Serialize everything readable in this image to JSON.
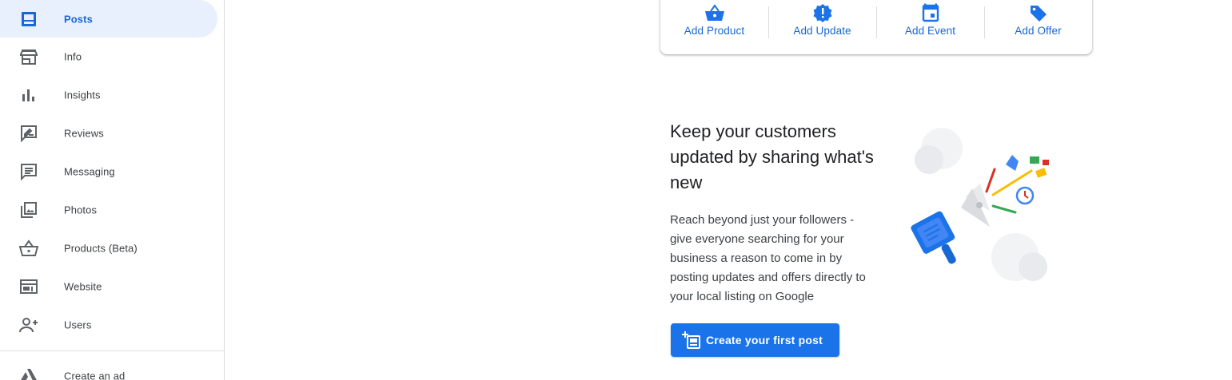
{
  "sidebar": {
    "items": [
      {
        "label": "Posts",
        "icon": "posts-icon",
        "active": true
      },
      {
        "label": "Info",
        "icon": "storefront-icon"
      },
      {
        "label": "Insights",
        "icon": "bar-chart-icon"
      },
      {
        "label": "Reviews",
        "icon": "rate-review-icon"
      },
      {
        "label": "Messaging",
        "icon": "message-icon"
      },
      {
        "label": "Photos",
        "icon": "photo-library-icon"
      },
      {
        "label": "Products (Beta)",
        "icon": "shopping-basket-icon"
      },
      {
        "label": "Website",
        "icon": "web-icon"
      },
      {
        "label": "Users",
        "icon": "person-add-icon"
      }
    ],
    "create_ad": {
      "label": "Create an ad",
      "icon": "ads-icon"
    }
  },
  "actions": [
    {
      "label": "Add Product",
      "icon": "basket-icon"
    },
    {
      "label": "Add Update",
      "icon": "update-badge-icon"
    },
    {
      "label": "Add Event",
      "icon": "calendar-icon"
    },
    {
      "label": "Add Offer",
      "icon": "tag-icon"
    }
  ],
  "empty_state": {
    "headline": "Keep your customers updated by sharing what's new",
    "description": "Reach beyond just your followers - give everyone searching for your business a reason to come in by posting updates and offers directly to your local listing on Google",
    "cta_label": "Create your first post",
    "illustration": "megaphone-illustration"
  },
  "colors": {
    "accent": "#1a73e8",
    "active_bg": "#e8f0fe",
    "active_text": "#1967d2",
    "icon_gray": "#5f6368"
  }
}
